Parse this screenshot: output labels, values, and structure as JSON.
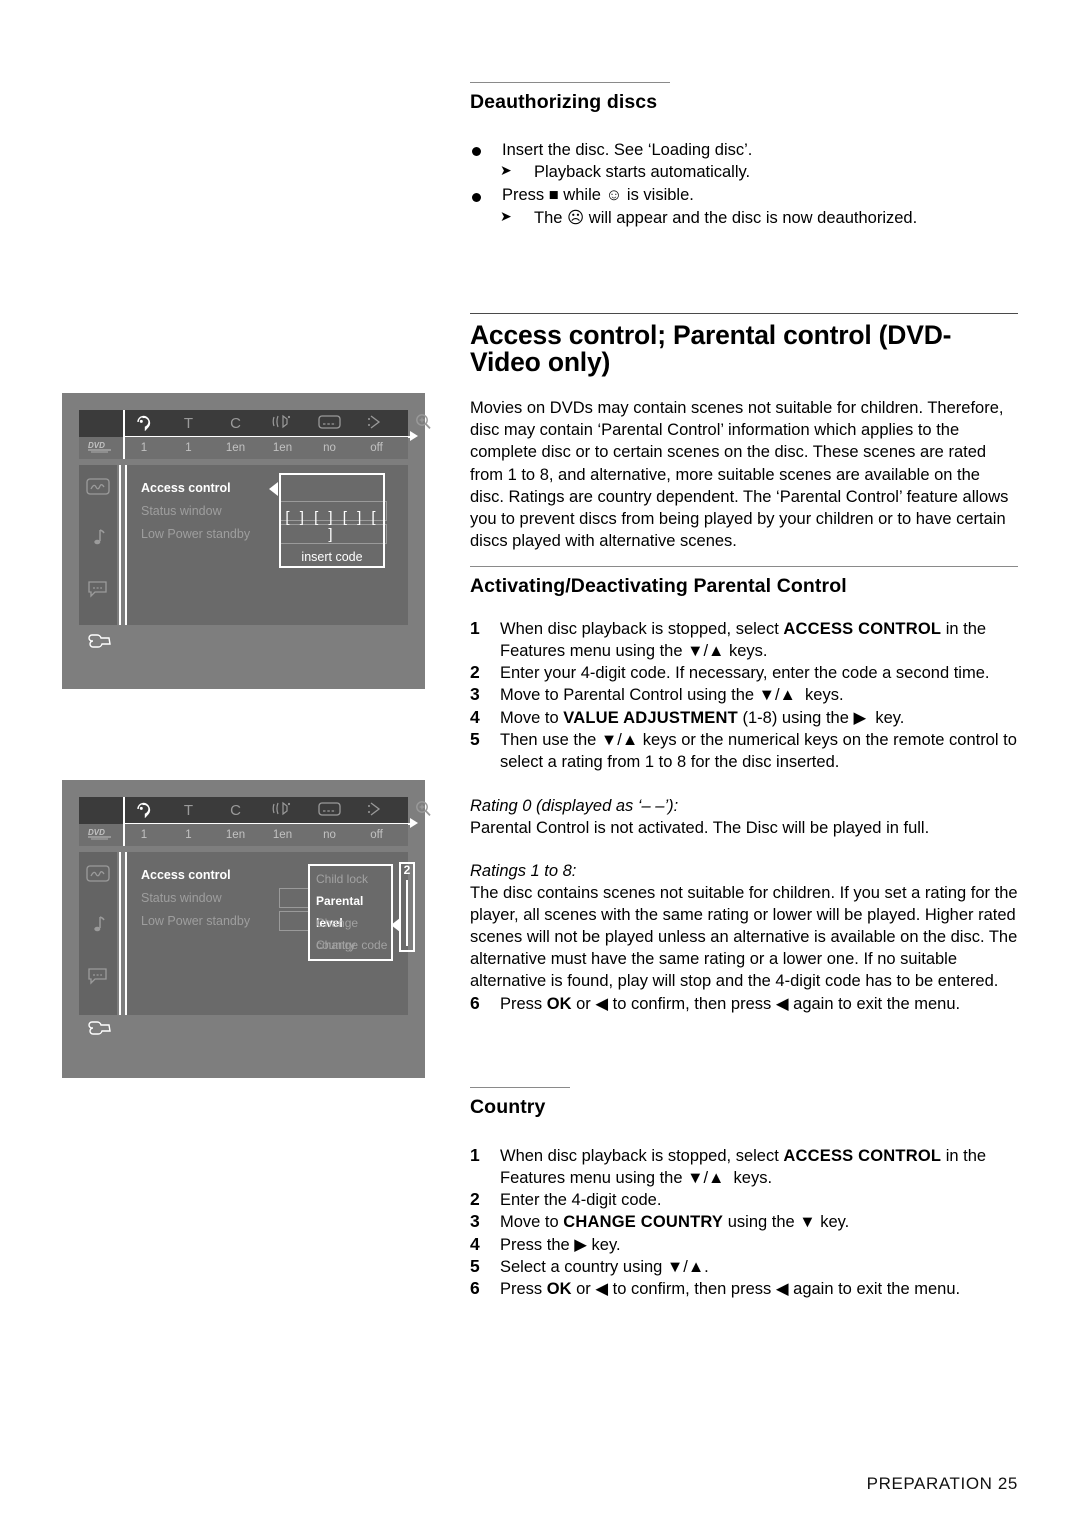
{
  "page": {
    "footer": "PREPARATION 25"
  },
  "deauthorizing": {
    "heading": "Deauthorizing discs",
    "bullets": [
      {
        "text": "Insert the disc. See ‘Loading disc’."
      },
      {
        "text": "Playback starts automatically.",
        "sub": true
      },
      {
        "text": "Press ■ while ☺ is visible."
      },
      {
        "text": "The ☹ will appear and the disc is now deauthorized.",
        "sub": true
      }
    ]
  },
  "access_control": {
    "title": "Access control; Parental control (DVD-Video only)",
    "intro": "Movies on DVDs may contain scenes not suitable for children. Therefore, disc may contain ‘Parental Control’ information which applies to the complete disc or to certain scenes on the disc. These scenes are rated from 1 to 8, and alternative, more suitable scenes are available on the disc. Ratings are country dependent. The ‘Parental Control’ feature allows you to prevent discs from being played by your children or to have certain discs played with alternative scenes."
  },
  "activating": {
    "heading": "Activating/Deactivating Parental Control",
    "steps": [
      {
        "n": "1",
        "html": "When disc playback is stopped, select <b class=\"caps\">ACCESS CONTROL</b> in the Features menu using the ▼/▲ keys."
      },
      {
        "n": "2",
        "html": "Enter your 4-digit code. If necessary, enter the code a second time."
      },
      {
        "n": "3",
        "html": "Move to Parental Control using the ▼/▲&nbsp; keys."
      },
      {
        "n": "4",
        "html": "Move to <b class=\"caps\">VALUE ADJUSTMENT</b> (1-8) using the ▶&nbsp; key."
      },
      {
        "n": "5",
        "html": "Then use the ▼/▲ keys or the numerical keys on the remote control to select a rating from 1 to 8 for the disc inserted."
      }
    ],
    "rating0_label": "Rating 0 (displayed as ‘– –’):",
    "rating0_text": "Parental Control is not activated. The Disc will be played in full.",
    "ratings18_label": "Ratings 1 to 8:",
    "ratings18_text": "The disc contains scenes not suitable for children. If you set a rating for the player, all scenes with the same rating or lower will be played. Higher rated scenes will not be played unless an alternative is available on the disc. The alternative must have the same rating or a lower one. If no suitable alternative is found, play will stop and the 4-digit code has to be entered.",
    "step6": {
      "n": "6",
      "html": "Press <b class=\"key\">OK</b> or ◀ to confirm, then press ◀ again to exit the menu."
    }
  },
  "country": {
    "heading": "Country",
    "steps": [
      {
        "n": "1",
        "html": "When disc playback is stopped, select <b class=\"caps\">ACCESS CONTROL</b> in the Features menu using the ▼/▲&nbsp; keys."
      },
      {
        "n": "2",
        "html": "Enter the 4-digit code."
      },
      {
        "n": "3",
        "html": "Move to <b class=\"caps\">CHANGE COUNTRY</b> using the ▼ key."
      },
      {
        "n": "4",
        "html": "Press the ▶ key."
      },
      {
        "n": "5",
        "html": "Select a country using ▼/▲."
      },
      {
        "n": "6",
        "html": "Press <b class=\"key\">OK</b> or ◀ to confirm, then press ◀ again to exit the menu."
      }
    ]
  },
  "screenshots": {
    "topbar": {
      "icons": [
        "face-icon",
        "T",
        "C",
        "audio-icon",
        "subtitle-icon",
        "angle-icon",
        "zoom-icon"
      ],
      "labels": [
        "",
        "T",
        "C",
        "",
        "",
        "",
        ""
      ],
      "disc_label": "DVD",
      "values": [
        "1",
        "1",
        "1en",
        "1en",
        "no",
        "off"
      ]
    },
    "menu_items": [
      {
        "label": "Access control",
        "selected": true
      },
      {
        "label": "Status window",
        "selected": false
      },
      {
        "label": "Low Power standby",
        "selected": false
      }
    ],
    "shot1": {
      "popup_brackets": "[ ] [ ] [ ] [ ]",
      "popup_caption": "insert code"
    },
    "shot2": {
      "sublist": [
        {
          "label": "Child lock",
          "selected": false
        },
        {
          "label": "Parental level",
          "selected": true
        },
        {
          "label": "Change country",
          "selected": false
        },
        {
          "label": "Change code",
          "selected": false
        }
      ],
      "slider_value": "2"
    }
  },
  "colors": {
    "panel_bg": "#7e7e7e",
    "topbar_bg": "#3b3b3b",
    "topbar_vals_bg": "#6f6f6f",
    "menu_bg": "#6a6a6a",
    "rail_bg": "#646464",
    "highlight": "#ffffff",
    "dim_text": "#9e9e9e"
  }
}
